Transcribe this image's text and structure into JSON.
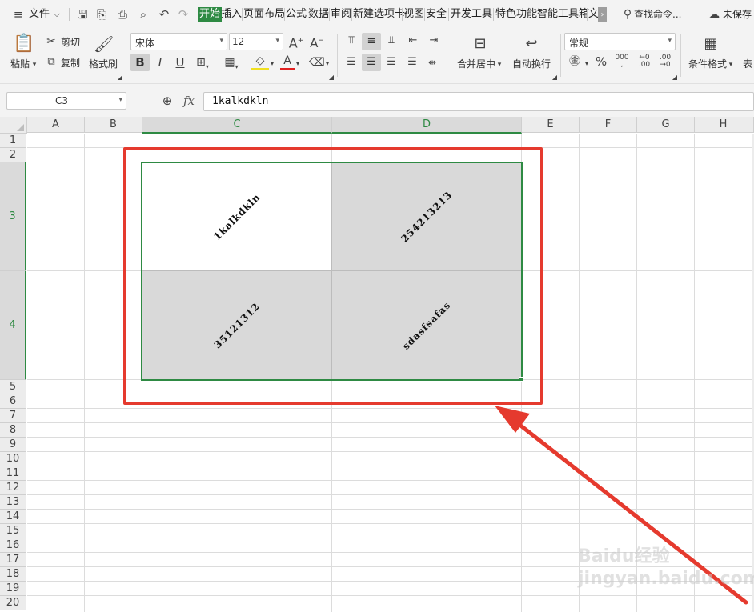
{
  "menubar": {
    "file_label": "文件",
    "tabs": [
      "开始",
      "插入",
      "页面布局",
      "公式",
      "数据",
      "审阅",
      "新建选项卡",
      "视图",
      "安全",
      "开发工具",
      "特色功能",
      "智能工具箱",
      "文"
    ],
    "active_tab": "开始",
    "search_label": "查找命令...",
    "save_status": "未保存"
  },
  "ribbon": {
    "paste": "粘贴",
    "cut": "剪切",
    "copy": "复制",
    "format_painter": "格式刷",
    "font_name": "宋体",
    "font_size": "12",
    "merge_center": "合并居中",
    "auto_wrap": "自动换行",
    "number_format": "常规",
    "conditional_format": "条件格式",
    "table_style": "表"
  },
  "formula_bar": {
    "name_box": "C3",
    "fx": "fx",
    "content": "1kalkdkln"
  },
  "sheet": {
    "columns": [
      "A",
      "B",
      "C",
      "D",
      "E",
      "F",
      "G",
      "H"
    ],
    "rows": [
      "1",
      "2",
      "3",
      "4",
      "5",
      "6",
      "7",
      "8",
      "9",
      "10",
      "11",
      "12",
      "13",
      "14",
      "15",
      "16",
      "17",
      "18",
      "19",
      "20"
    ],
    "cells": {
      "C3": "1kalkdkln",
      "D3": "254213213",
      "C4": "35121312",
      "D4": "sdasfsafas"
    }
  },
  "colors": {
    "accent": "#2e8a43",
    "annotation": "#e53a2e",
    "shade": "#d9d9d9"
  },
  "watermark": "Baidu经验 jingyan.baidu.com"
}
